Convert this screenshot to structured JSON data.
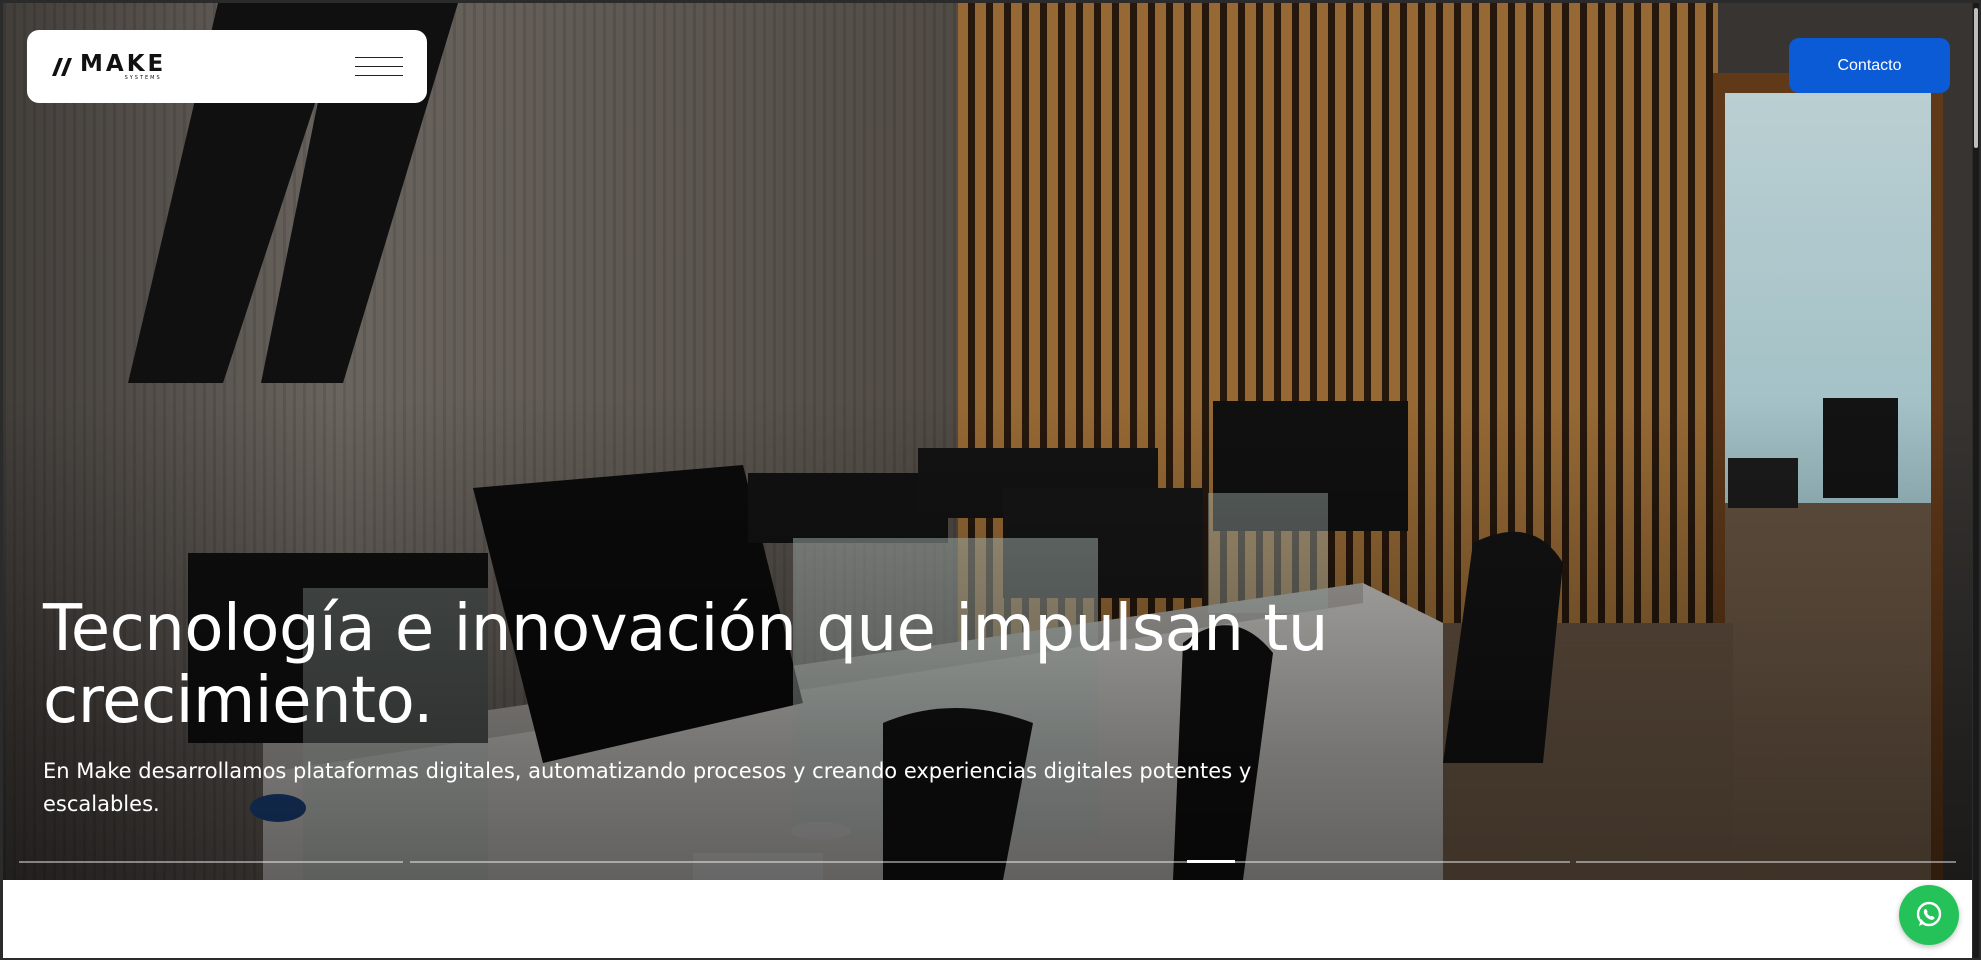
{
  "header": {
    "logo_text": "MAKE",
    "logo_subtext": "SYSTEMS",
    "menu_icon": "hamburger-menu-icon",
    "contact_label": "Contacto"
  },
  "hero": {
    "title": "Tecnología e innovación que impulsan tu crecimiento.",
    "subtitle": "En Make desarrollamos plataformas digitales, automatizando procesos y creando experiencias digitales potentes y escalables.",
    "slider": {
      "slides": 4,
      "active_index": 2
    }
  },
  "floating": {
    "whatsapp_icon": "whatsapp-icon"
  },
  "colors": {
    "accent": "#0b5bd6",
    "whatsapp": "#25c25a"
  }
}
